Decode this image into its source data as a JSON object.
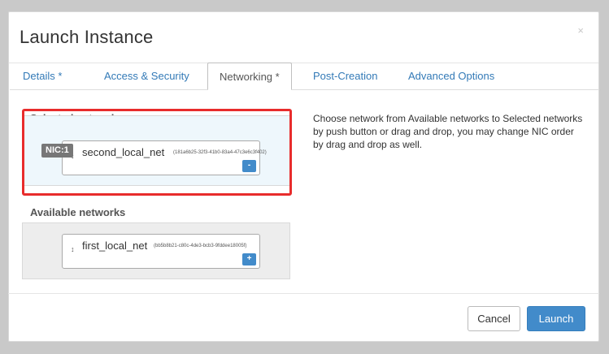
{
  "dialog": {
    "title": "Launch Instance",
    "close_glyph": "×"
  },
  "tabs": [
    {
      "label": "Details *",
      "active": false
    },
    {
      "label": "Access & Security",
      "active": false
    },
    {
      "label": "Networking *",
      "active": true
    },
    {
      "label": "Post-Creation",
      "active": false
    },
    {
      "label": "Advanced Options",
      "active": false
    }
  ],
  "selected_networks": {
    "title": "Selected networks",
    "items": [
      {
        "nic_label": "NIC:1",
        "name": "second_local_net",
        "id": "(181a6b25-32f3-41b0-83a4-47c3e6c3f402)",
        "action": "-"
      }
    ]
  },
  "available_networks": {
    "title": "Available networks",
    "items": [
      {
        "name": "first_local_net",
        "id": "(bb5b8b21-c80c-4de3-bcb3-9fddee18005f)",
        "action": "+"
      }
    ]
  },
  "help_text": "Choose network from Available networks to Selected networks by push button or drag and drop, you may change NIC order by drag and drop as well.",
  "footer": {
    "cancel_label": "Cancel",
    "launch_label": "Launch"
  },
  "icons": {
    "sort": "sort-updown-icon",
    "close": "close-icon"
  },
  "colors": {
    "primary": "#428bca",
    "link": "#337ab7",
    "highlight": "#e82c2c",
    "selected_zone_bg": "#eef7fc",
    "available_zone_bg": "#ededed"
  }
}
